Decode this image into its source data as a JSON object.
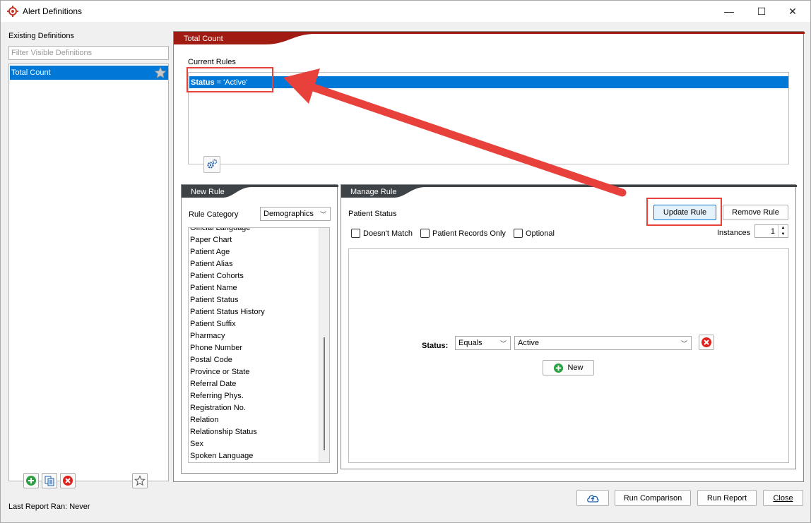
{
  "window": {
    "title": "Alert Definitions",
    "minimize": "—",
    "maximize": "☐",
    "close": "✕"
  },
  "left_panel": {
    "label": "Existing Definitions",
    "filter_placeholder": "Filter Visible Definitions",
    "definitions": [
      {
        "name": "Total Count",
        "selected": true,
        "favorite": true
      }
    ],
    "last_report": "Last Report Ran: Never"
  },
  "main": {
    "tab_label": "Total Count",
    "current_rules_label": "Current Rules",
    "rules": [
      {
        "field": "Status",
        "op_value": " = 'Active'"
      }
    ]
  },
  "new_rule": {
    "header": "New Rule",
    "category_label": "Rule Category",
    "category_value": "Demographics",
    "categories": [
      "Official Language",
      "Paper Chart",
      "Patient Age",
      "Patient Alias",
      "Patient Cohorts",
      "Patient Name",
      "Patient Status",
      "Patient Status History",
      "Patient Suffix",
      "Pharmacy",
      "Phone Number",
      "Postal Code",
      "Province or State",
      "Referral Date",
      "Referring Phys.",
      "Registration No.",
      "Relation",
      "Relationship Status",
      "Sex",
      "Spoken Language"
    ]
  },
  "manage_rule": {
    "header": "Manage Rule",
    "title": "Patient Status",
    "update_button": "Update Rule",
    "remove_button": "Remove Rule",
    "doesnt_match": "Doesn't Match",
    "patient_records_only": "Patient Records Only",
    "optional": "Optional",
    "instances_label": "Instances",
    "instances_value": "1",
    "condition_label": "Status:",
    "operator_value": "Equals",
    "value_value": "Active",
    "new_button": "New"
  },
  "footer": {
    "run_comparison": "Run Comparison",
    "run_report": "Run Report",
    "close": "Close"
  },
  "colors": {
    "selection": "#0078d7",
    "header_dark": "#3d4347",
    "accent_red": "#a01c12",
    "annotation": "#e8413c"
  }
}
